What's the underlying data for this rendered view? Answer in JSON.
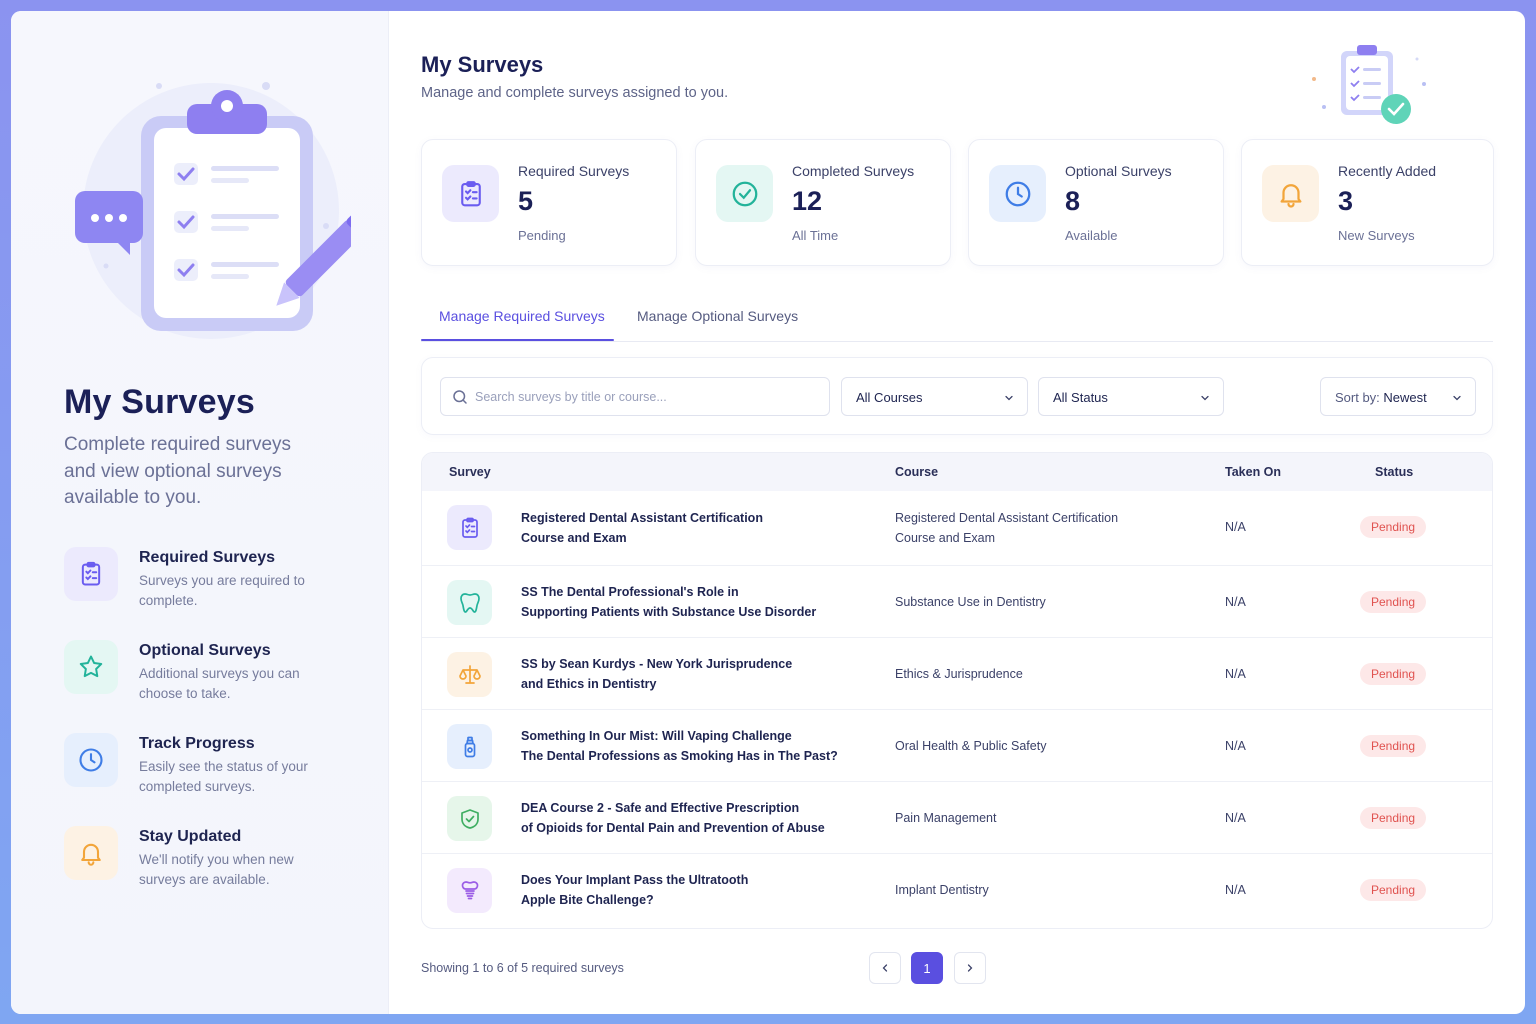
{
  "colors": {
    "accent": "#5a4fe0",
    "pending_bg": "#fde8e8",
    "pending_text": "#e0524f"
  },
  "left": {
    "title": "My Surveys",
    "subtitle": "Complete required surveys and view optional surveys available to you.",
    "features": [
      {
        "icon": "clipboard-list-icon",
        "title": "Required Surveys",
        "desc": "Surveys you are required to complete."
      },
      {
        "icon": "star-icon",
        "title": "Optional Surveys",
        "desc": "Additional surveys you can choose to take."
      },
      {
        "icon": "clock-icon",
        "title": "Track Progress",
        "desc": "Easily see the status of your completed surveys."
      },
      {
        "icon": "bell-icon",
        "title": "Stay Updated",
        "desc": "We'll notify you when new surveys are available."
      }
    ]
  },
  "header": {
    "title": "My Surveys",
    "subtitle": "Manage and complete surveys assigned to you."
  },
  "stats": [
    {
      "icon": "clipboard-list-icon",
      "label": "Required Surveys",
      "value": "5",
      "foot": "Pending"
    },
    {
      "icon": "check-circle-icon",
      "label": "Completed Surveys",
      "value": "12",
      "foot": "All Time"
    },
    {
      "icon": "clock-icon",
      "label": "Optional Surveys",
      "value": "8",
      "foot": "Available"
    },
    {
      "icon": "bell-icon",
      "label": "Recently Added",
      "value": "3",
      "foot": "New Surveys"
    }
  ],
  "tabs": [
    {
      "label": "Manage Required Surveys",
      "active": true
    },
    {
      "label": "Manage Optional Surveys",
      "active": false
    }
  ],
  "filters": {
    "search_placeholder": "Search surveys by title or course...",
    "course": "All Courses",
    "status": "All Status",
    "sort_label": "Sort by:",
    "sort_value": "Newest"
  },
  "table": {
    "headers": {
      "survey": "Survey",
      "course": "Course",
      "taken": "Taken On",
      "status": "Status"
    },
    "rows": [
      {
        "icon": "clipboard-list-icon",
        "title1": "Registered Dental Assistant Certification",
        "title2": "Course and Exam",
        "course1": "Registered Dental Assistant Certification",
        "course2": "Course and Exam",
        "taken": "N/A",
        "status": "Pending"
      },
      {
        "icon": "tooth-icon",
        "title1": "SS The Dental Professional's Role in",
        "title2": "Supporting Patients with Substance Use Disorder",
        "course1": "Substance Use in Dentistry",
        "course2": "",
        "taken": "N/A",
        "status": "Pending"
      },
      {
        "icon": "scales-icon",
        "title1": "SS by Sean Kurdys - New York Jurisprudence",
        "title2": "and Ethics in Dentistry",
        "course1": "Ethics & Jurisprudence",
        "course2": "",
        "taken": "N/A",
        "status": "Pending"
      },
      {
        "icon": "bottle-icon",
        "title1": "Something In Our Mist: Will Vaping Challenge",
        "title2": "The Dental Professions as Smoking Has in The Past?",
        "course1": "Oral Health & Public Safety",
        "course2": "",
        "taken": "N/A",
        "status": "Pending"
      },
      {
        "icon": "shield-check-icon",
        "title1": "DEA Course 2 - Safe and Effective Prescription",
        "title2": "of Opioids for Dental Pain and Prevention of Abuse",
        "course1": "Pain Management",
        "course2": "",
        "taken": "N/A",
        "status": "Pending"
      },
      {
        "icon": "implant-icon",
        "title1": "Does Your Implant Pass the Ultratooth",
        "title2": "Apple Bite Challenge?",
        "course1": "Implant Dentistry",
        "course2": "",
        "taken": "N/A",
        "status": "Pending"
      }
    ]
  },
  "footer": {
    "showing": "Showing 1 to 6 of 5 required surveys",
    "page": "1"
  }
}
